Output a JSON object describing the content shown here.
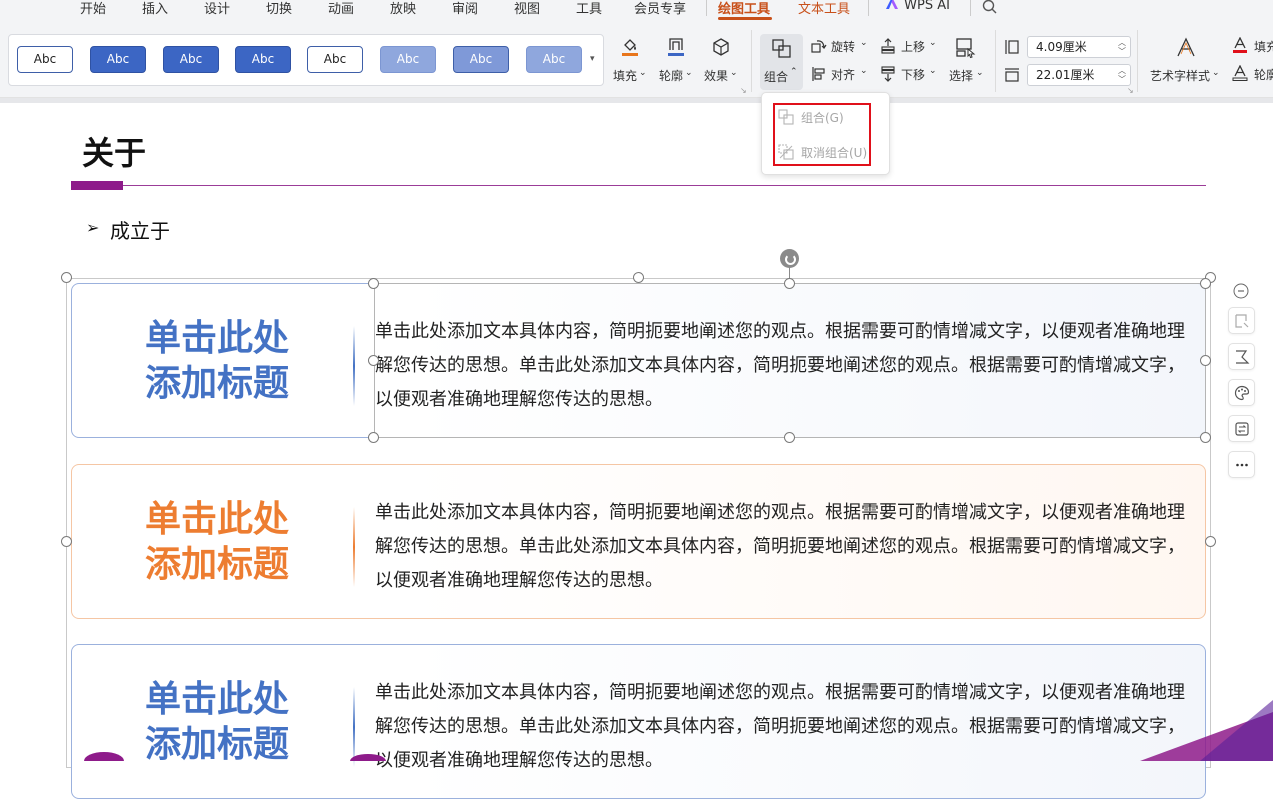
{
  "menu": {
    "tabs": [
      {
        "label": "开始"
      },
      {
        "label": "插入"
      },
      {
        "label": "设计"
      },
      {
        "label": "切换"
      },
      {
        "label": "动画"
      },
      {
        "label": "放映"
      },
      {
        "label": "审阅"
      },
      {
        "label": "视图"
      },
      {
        "label": "工具"
      },
      {
        "label": "会员专享"
      },
      {
        "label": "绘图工具"
      },
      {
        "label": "文本工具"
      },
      {
        "label": "WPS AI"
      }
    ],
    "active_tab": "绘图工具"
  },
  "ribbon": {
    "shape_styles": [
      "Abc",
      "Abc",
      "Abc",
      "Abc",
      "Abc",
      "Abc",
      "Abc",
      "Abc"
    ],
    "fill_label": "填充",
    "outline_label": "轮廓",
    "effect_label": "效果",
    "group_label": "组合",
    "rotate_label": "旋转",
    "align_label": "对齐",
    "bring_forward_label": "上移",
    "send_backward_label": "下移",
    "select_label": "选择",
    "height_value": "4.09厘米",
    "width_value": "22.01厘米",
    "wordart_label": "艺术字样式",
    "text_fill_label": "填充",
    "text_outline_label": "轮廓"
  },
  "dropdown": {
    "group_item": "组合(G)",
    "ungroup_item": "取消组合(U)"
  },
  "slide": {
    "title": "关于",
    "bullet": "成立于",
    "cards": [
      {
        "heading_line1": "单击此处",
        "heading_line2": "添加标题",
        "body": "单击此处添加文本具体内容，简明扼要地阐述您的观点。根据需要可酌情增减文字，以便观者准确地理解您传达的思想。单击此处添加文本具体内容，简明扼要地阐述您的观点。根据需要可酌情增减文字，以便观者准确地理解您传达的思想。"
      },
      {
        "heading_line1": "单击此处",
        "heading_line2": "添加标题",
        "body": "单击此处添加文本具体内容，简明扼要地阐述您的观点。根据需要可酌情增减文字，以便观者准确地理解您传达的思想。单击此处添加文本具体内容，简明扼要地阐述您的观点。根据需要可酌情增减文字，以便观者准确地理解您传达的思想。"
      },
      {
        "heading_line1": "单击此处",
        "heading_line2": "添加标题",
        "body": "单击此处添加文本具体内容，简明扼要地阐述您的观点。根据需要可酌情增减文字，以便观者准确地理解您传达的思想。单击此处添加文本具体内容，简明扼要地阐述您的观点。根据需要可酌情增减文字，以便观者准确地理解您传达的思想。"
      }
    ]
  },
  "colors": {
    "accent_orange": "#c8501a",
    "title_purple": "#8e1b8a",
    "card_blue": "#4472c4",
    "card_orange": "#ed7d31",
    "highlight_red": "#e0101a"
  }
}
